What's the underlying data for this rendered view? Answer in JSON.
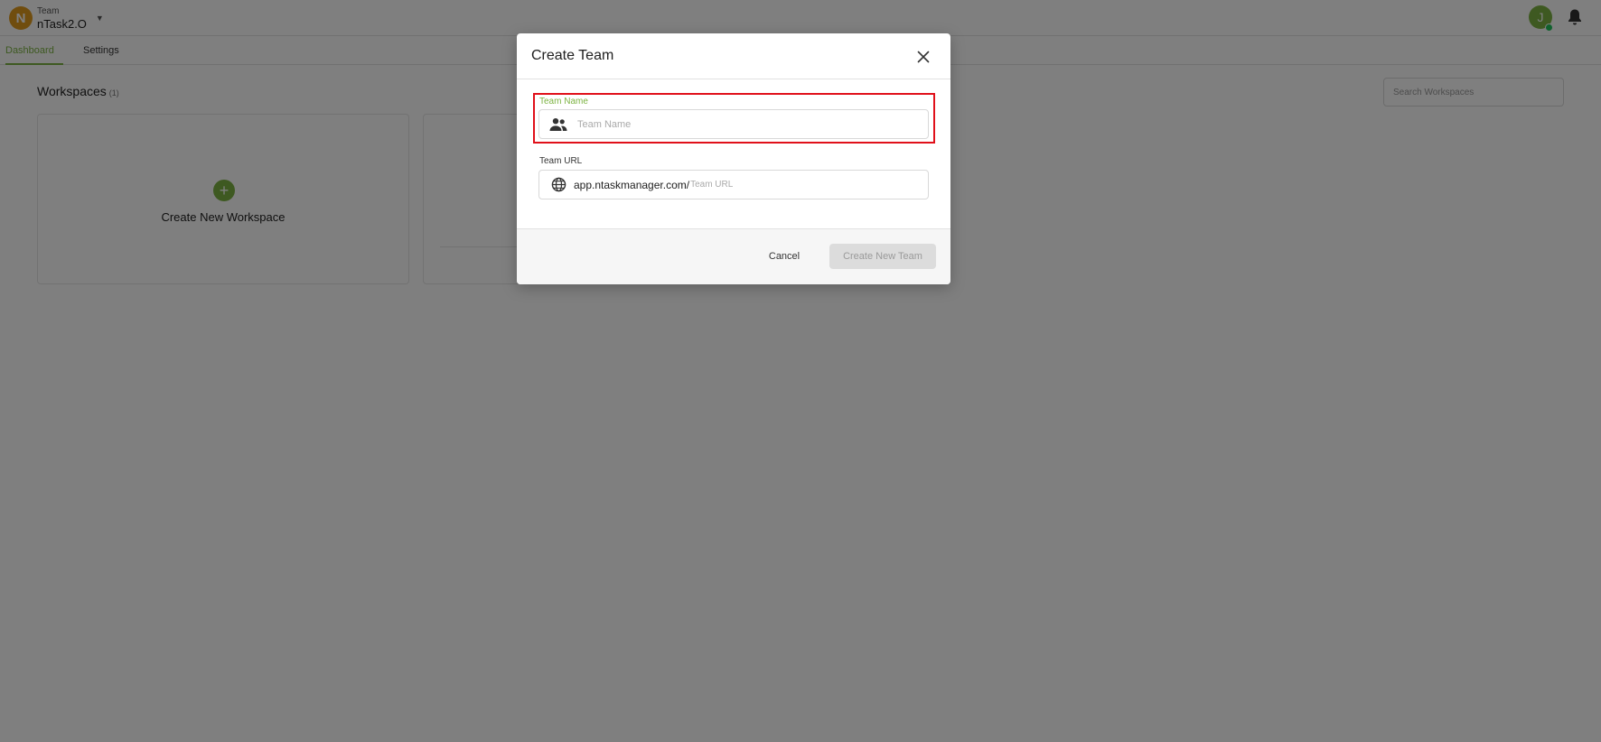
{
  "header": {
    "team_caption": "Team",
    "team_name": "nTask2.O",
    "team_avatar_letter": "N",
    "user_avatar_letter": "J",
    "icons": {
      "chevron": "chevron-down-icon",
      "bell": "bell-icon"
    }
  },
  "tabs": [
    {
      "label": "Dashboard",
      "active": true
    },
    {
      "label": "Settings",
      "active": false
    }
  ],
  "workspaces": {
    "title": "Workspaces",
    "count": "(1)",
    "search_placeholder": "Search Workspaces",
    "create_label": "Create New Workspace"
  },
  "modal": {
    "title": "Create Team",
    "team_name": {
      "label": "Team Name",
      "placeholder": "Team Name",
      "value": "",
      "icon": "team-icon"
    },
    "team_url": {
      "label": "Team URL",
      "prefix": "app.ntaskmanager.com/",
      "placeholder": "Team URL",
      "value": "",
      "icon": "globe-icon"
    },
    "cancel_label": "Cancel",
    "create_label": "Create New Team"
  },
  "colors": {
    "accent": "#7cb342",
    "team_avatar": "#e09a1c",
    "highlight": "#e0101a",
    "presence": "#20c35a"
  }
}
